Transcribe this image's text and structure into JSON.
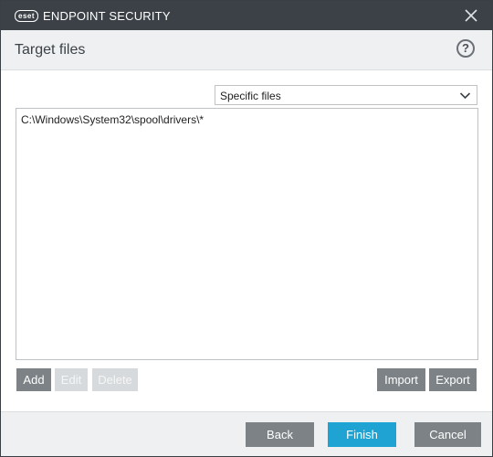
{
  "titlebar": {
    "brand_badge": "eset",
    "product": "ENDPOINT SECURITY"
  },
  "header": {
    "title": "Target files",
    "help_label": "?"
  },
  "target_type": {
    "selected": "Specific files"
  },
  "file_list": {
    "items": [
      "C:\\Windows\\System32\\spool\\drivers\\*"
    ]
  },
  "list_actions": {
    "add": "Add",
    "edit": "Edit",
    "delete": "Delete",
    "import": "Import",
    "export": "Export"
  },
  "footer": {
    "back": "Back",
    "finish": "Finish",
    "cancel": "Cancel"
  },
  "colors": {
    "titlebar": "#3b4147",
    "accent": "#1fa3d2",
    "button_gray": "#7c8286"
  },
  "icons": {
    "close": "close-icon",
    "dropdown": "chevron-down-icon"
  }
}
